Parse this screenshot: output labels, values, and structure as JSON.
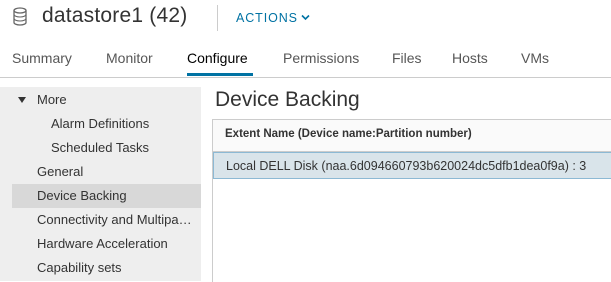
{
  "header": {
    "icon": "datastore-icon",
    "title": "datastore1 (42)",
    "actions_label": "ACTIONS"
  },
  "tabs": [
    {
      "label": "Summary"
    },
    {
      "label": "Monitor"
    },
    {
      "label": "Configure",
      "active": true
    },
    {
      "label": "Permissions"
    },
    {
      "label": "Files"
    },
    {
      "label": "Hosts"
    },
    {
      "label": "VMs"
    }
  ],
  "sidebar": {
    "items": [
      {
        "label": "More",
        "expanded": true
      },
      {
        "label": "Alarm Definitions"
      },
      {
        "label": "Scheduled Tasks"
      },
      {
        "label": "General"
      },
      {
        "label": "Device Backing",
        "selected": true
      },
      {
        "label": "Connectivity and Multipathing"
      },
      {
        "label": "Hardware Acceleration"
      },
      {
        "label": "Capability sets"
      }
    ]
  },
  "main": {
    "title": "Device Backing",
    "grid": {
      "columns": [
        "Extent Name (Device name:Partition number)"
      ],
      "rows": [
        {
          "extent": "Local DELL Disk (naa.6d094660793b620024dc5dfb1dea0f9a) : 3",
          "selected": true
        }
      ]
    }
  },
  "colors": {
    "accent": "#0072a3",
    "sidebar_bg": "#eeeeee",
    "selected_row": "#d9e4ea"
  }
}
